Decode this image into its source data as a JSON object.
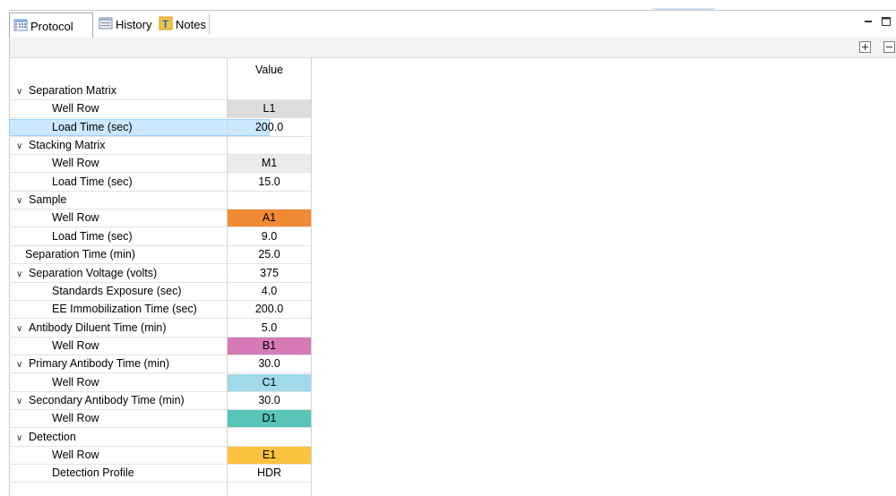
{
  "tabs": [
    {
      "label": "Protocol",
      "icon": "grid-table-icon",
      "active": true
    },
    {
      "label": "History",
      "icon": "history-icon",
      "active": false
    },
    {
      "label": "Notes",
      "icon": "notes-icon",
      "active": false
    }
  ],
  "header": {
    "value_col": "Value"
  },
  "rows": [
    {
      "label": "Separation Matrix",
      "value": "",
      "group": true,
      "expanded": true
    },
    {
      "label": "Well Row",
      "value": "L1",
      "color": "#dcdcdc"
    },
    {
      "label": "Load Time (sec)",
      "value": "200.0",
      "selected": true
    },
    {
      "label": "Stacking Matrix",
      "value": "",
      "group": true,
      "expanded": true
    },
    {
      "label": "Well Row",
      "value": "M1",
      "color": "#ebebeb"
    },
    {
      "label": "Load Time (sec)",
      "value": "15.0"
    },
    {
      "label": "Sample",
      "value": "",
      "group": true,
      "expanded": true
    },
    {
      "label": "Well Row",
      "value": "A1",
      "color": "#f28a34"
    },
    {
      "label": "Load Time (sec)",
      "value": "9.0"
    },
    {
      "label": "Separation Time (min)",
      "value": "25.0",
      "top": true
    },
    {
      "label": "Separation Voltage (volts)",
      "value": "375",
      "group": true,
      "expanded": true
    },
    {
      "label": "Standards Exposure (sec)",
      "value": "4.0"
    },
    {
      "label": "EE Immobilization Time (sec)",
      "value": "200.0"
    },
    {
      "label": "Antibody Diluent Time (min)",
      "value": "5.0",
      "group": true,
      "expanded": true
    },
    {
      "label": "Well Row",
      "value": "B1",
      "color": "#d57ab6"
    },
    {
      "label": "Primary Antibody Time (min)",
      "value": "30.0",
      "group": true,
      "expanded": true
    },
    {
      "label": "Well Row",
      "value": "C1",
      "color": "#9fd9ea"
    },
    {
      "label": "Secondary Antibody Time (min)",
      "value": "30.0",
      "group": true,
      "expanded": true
    },
    {
      "label": "Well Row",
      "value": "D1",
      "color": "#58c4b8"
    },
    {
      "label": "Detection",
      "value": "",
      "group": true,
      "expanded": true
    },
    {
      "label": "Well Row",
      "value": "E1",
      "color": "#fcc23f"
    },
    {
      "label": "Detection Profile",
      "value": "HDR"
    }
  ]
}
